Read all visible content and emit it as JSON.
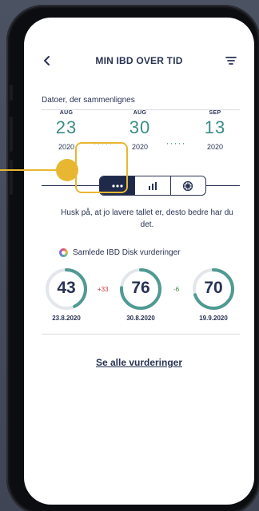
{
  "header": {
    "title": "MIN IBD OVER TID"
  },
  "compare": {
    "label": "Datoer, der sammenlignes"
  },
  "dates": [
    {
      "month": "AUG",
      "day": "23",
      "year": "2020"
    },
    {
      "month": "AUG",
      "day": "30",
      "year": "2020"
    },
    {
      "month": "SEP",
      "day": "13",
      "year": "2020"
    }
  ],
  "dots": "·····",
  "view_toggle": {
    "options": [
      "list-view",
      "bar-chart-view",
      "disk-view"
    ],
    "active": 0
  },
  "hint": "Husk på, at jo lavere tallet er, desto bedre har du det.",
  "ratings": {
    "title": "Samlede IBD Disk vurderinger",
    "scores": [
      {
        "value": "43",
        "date": "23.8.2020",
        "fraction": 0.43
      },
      {
        "value": "76",
        "date": "30.8.2020",
        "fraction": 0.76
      },
      {
        "value": "70",
        "date": "19.9.2020",
        "fraction": 0.7
      }
    ],
    "deltas": [
      "+33",
      "-6"
    ]
  },
  "see_all": "Se alle vurderinger",
  "colors": {
    "accent": "#3d8c86",
    "navy": "#283353",
    "highlight": "#e8b732"
  }
}
